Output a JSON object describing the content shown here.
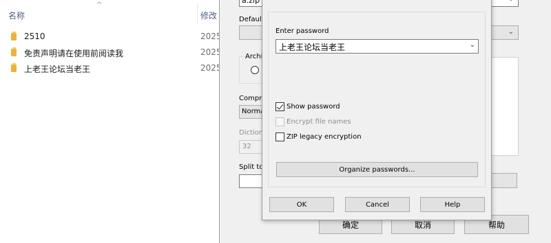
{
  "explorer": {
    "col_name": "名称",
    "col_modified": "修改",
    "sort_arrow": "^",
    "files": [
      {
        "name": "2510",
        "date": "2025"
      },
      {
        "name": "免责声明请在使用前阅读我",
        "date": "2025"
      },
      {
        "name": "上老王论坛当老王",
        "date": "2025"
      }
    ]
  },
  "archive_dialog": {
    "archive_name": "a.zip",
    "default_label": "Default",
    "archive_label": "Archiv",
    "compress_label": "Compre",
    "compress_value": "Norma",
    "dictionary_label": "Dictiona",
    "dictionary_value": "32",
    "split_label": "Split to",
    "ok_button": "确定",
    "cancel_button": "取消",
    "help_button": "帮助"
  },
  "password_dialog": {
    "enter_password_label": "Enter password",
    "password_value": "上老王论坛当老王",
    "show_password_label": "Show password",
    "show_password_checked": true,
    "encrypt_file_names_label": "Encrypt file names",
    "encrypt_file_names_enabled": false,
    "zip_legacy_label": "ZIP legacy encryption",
    "zip_legacy_checked": false,
    "organize_button": "Organize passwords...",
    "ok_button": "OK",
    "cancel_button": "Cancel",
    "help_button": "Help"
  },
  "icons": {
    "folder": "folder-icon",
    "chevron": "chevron-down-icon",
    "checkmark": "checkmark-icon"
  },
  "colors": {
    "folder": "#e9b43a",
    "header_text": "#4d6082",
    "dialog_bg": "#f0f0f0",
    "button_bg": "#e1e1e1"
  }
}
